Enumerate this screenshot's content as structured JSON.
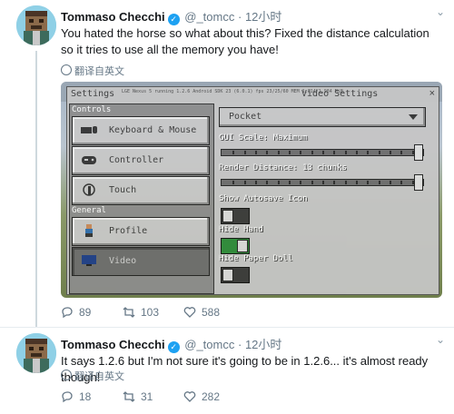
{
  "tweets": [
    {
      "name": "Tommaso Checchi",
      "handle": "@_tomcc",
      "separator": "·",
      "time": "12小时",
      "text": "You hated the horse so what about this? Fixed the distance calculation so it tries to use all the memory you have!",
      "translate": "翻译自英文",
      "replies": "89",
      "retweets": "103",
      "likes": "588"
    },
    {
      "name": "Tommaso Checchi",
      "handle": "@_tomcc",
      "separator": "·",
      "time": "12小时",
      "text": "It says 1.2.6 but I'm not sure it's going to be in 1.2.6... it's almost ready though!",
      "translate": "翻译自英文",
      "replies": "18",
      "retweets": "31",
      "likes": "282"
    }
  ],
  "media": {
    "settings_title": "Settings",
    "video_title": "Video Settings",
    "info_strip": "LGE Nexus 5 running 1.2.6 Android SDK 23 (6.0.1) fps 23/25/60 MEM 1,014/1,984 MiB",
    "close": "×",
    "controls_label": "Controls",
    "general_label": "General",
    "left_buttons": [
      {
        "label": "Keyboard & Mouse",
        "icon": "keyboard-mouse-icon"
      },
      {
        "label": "Controller",
        "icon": "controller-icon"
      },
      {
        "label": "Touch",
        "icon": "touch-icon"
      },
      {
        "label": "Profile",
        "icon": "profile-icon"
      },
      {
        "label": "Video",
        "icon": "video-icon"
      }
    ],
    "dropdown_value": "Pocket",
    "gui_scale_label": "GUI Scale: Maximum",
    "gui_scale_fraction": 1.0,
    "render_distance_label": "Render Distance: 13 chunks",
    "render_distance_fraction": 1.0,
    "autosave_label": "Show Autosave Icon",
    "autosave_on": false,
    "hide_hand_label": "Hide Hand",
    "hide_hand_on": true,
    "hide_paper_doll_label": "Hide Paper Doll",
    "hide_paper_doll_on": false
  },
  "colors": {
    "accent": "#1da1f2",
    "text_secondary": "#657786",
    "toggle_on": "#2e8b3a"
  }
}
